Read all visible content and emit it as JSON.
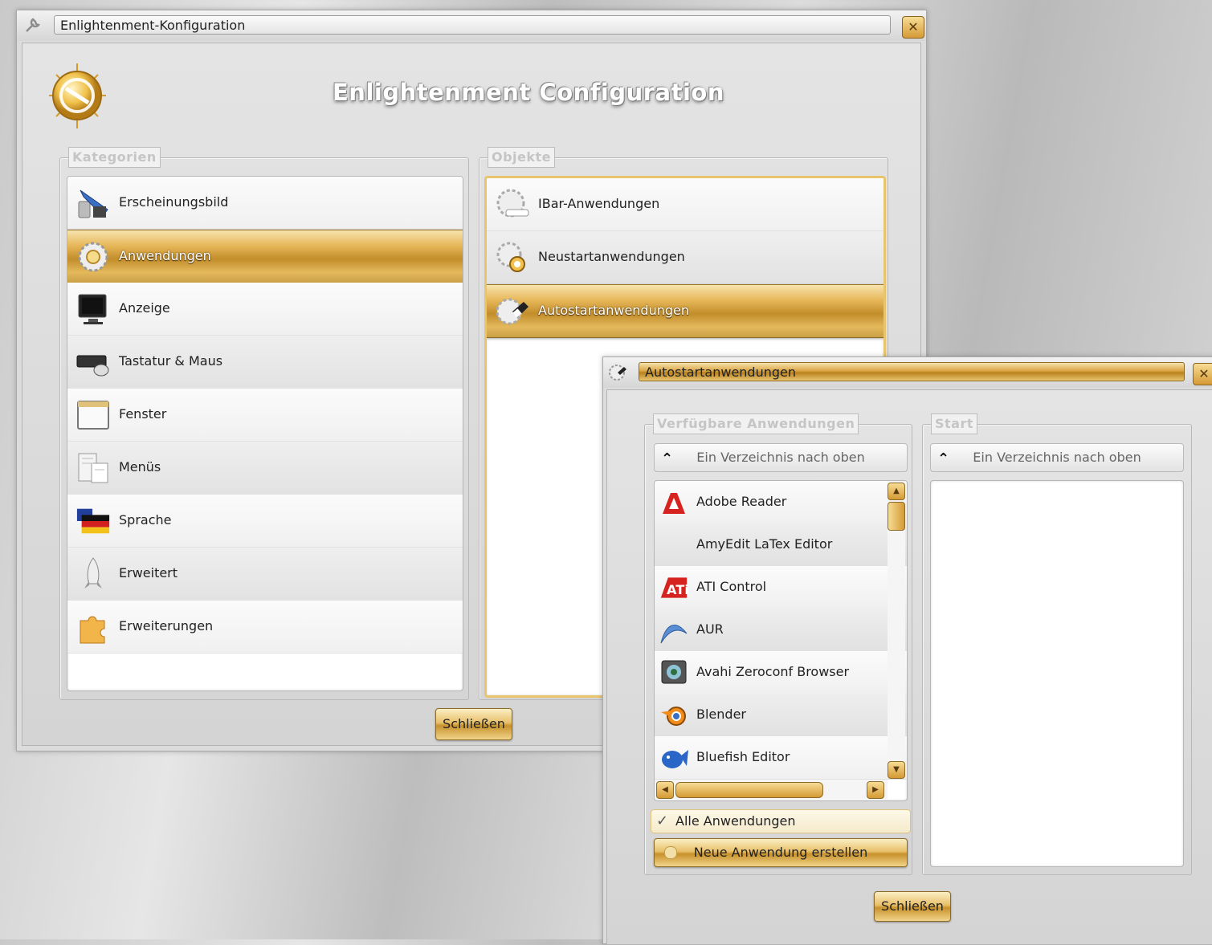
{
  "main_window": {
    "title": "Enlightenment-Konfiguration",
    "close_glyph": "✕",
    "header_title": "Enlightenment Configuration",
    "categories_legend": "Kategorien",
    "objects_legend": "Objekte",
    "categories": [
      {
        "label": "Erscheinungsbild",
        "icon": "appearance-icon"
      },
      {
        "label": "Anwendungen",
        "icon": "applications-icon",
        "selected": true
      },
      {
        "label": "Anzeige",
        "icon": "monitor-icon"
      },
      {
        "label": "Tastatur & Maus",
        "icon": "keyboard-mouse-icon"
      },
      {
        "label": "Fenster",
        "icon": "window-icon"
      },
      {
        "label": "Menüs",
        "icon": "menu-icon"
      },
      {
        "label": "Sprache",
        "icon": "flag-icon"
      },
      {
        "label": "Erweitert",
        "icon": "rocket-icon"
      },
      {
        "label": "Erweiterungen",
        "icon": "puzzle-icon"
      }
    ],
    "objects": [
      {
        "label": "IBar-Anwendungen",
        "icon": "ibar-icon"
      },
      {
        "label": "Neustartanwendungen",
        "icon": "restart-icon"
      },
      {
        "label": "Autostartanwendungen",
        "icon": "autostart-icon",
        "selected": true
      }
    ],
    "close_button": "Schließen"
  },
  "autostart_window": {
    "title": "Autostartanwendungen",
    "close_glyph": "✕",
    "available_legend": "Verfügbare Anwendungen",
    "start_legend": "Start",
    "up_dir_label": "Ein Verzeichnis nach oben",
    "up_glyph": "⌃",
    "apps": [
      {
        "label": "Adobe Reader",
        "icon": "adobe-reader-icon"
      },
      {
        "label": "AmyEdit LaTex Editor",
        "icon": ""
      },
      {
        "label": "ATI Control",
        "icon": "ati-icon"
      },
      {
        "label": "AUR",
        "icon": "arch-icon"
      },
      {
        "label": "Avahi Zeroconf Browser",
        "icon": "avahi-icon"
      },
      {
        "label": "Blender",
        "icon": "blender-icon"
      },
      {
        "label": "Bluefish Editor",
        "icon": "bluefish-icon"
      }
    ],
    "all_apps_checkbox": "Alle Anwendungen",
    "all_apps_checked": true,
    "check_glyph": "✓",
    "new_app_button": "Neue Anwendung erstellen",
    "close_button": "Schließen"
  },
  "colors": {
    "accent_gold": "#d9a441",
    "selection_dark": "#b8862a",
    "window_bg": "#dcdcdc"
  }
}
